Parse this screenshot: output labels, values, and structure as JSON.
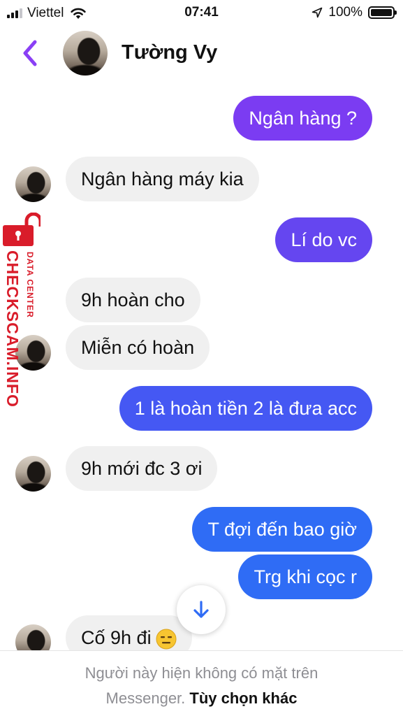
{
  "status_bar": {
    "carrier": "Viettel",
    "time": "07:41",
    "battery": "100%"
  },
  "header": {
    "contact_name": "Tường Vy"
  },
  "messages": [
    {
      "side": "out",
      "text": "Ngân hàng ?"
    },
    {
      "side": "in",
      "text": "Ngân hàng máy kia"
    },
    {
      "side": "out",
      "text": "Lí do vc"
    },
    {
      "side": "in",
      "text": "9h hoàn cho"
    },
    {
      "side": "in",
      "text": "Miễn có hoàn"
    },
    {
      "side": "out",
      "text": "1 là hoàn tiền 2 là đưa acc"
    },
    {
      "side": "in",
      "text": "9h mới đc 3 ơi"
    },
    {
      "side": "out",
      "text": "T đợi đến bao giờ"
    },
    {
      "side": "out",
      "text": "Trg khi cọc r"
    },
    {
      "side": "in",
      "text": "Cố 9h đi",
      "emoji": "expressionless-face-emoji"
    }
  ],
  "watermark": {
    "brand": "CHECKSCAM.INFO",
    "subtitle": "DATA CENTER"
  },
  "footer": {
    "line1": "Người này hiện không có mặt trên",
    "line2_prefix": "Messenger.",
    "line2_link": "Tùy chọn khác"
  },
  "colors": {
    "outgoing_purple": "#7b3cf2",
    "outgoing_violet": "#6546f0",
    "outgoing_indigo": "#4558f3",
    "outgoing_blue": "#2f6cf5",
    "incoming_gray": "#f0f0f0",
    "back_chevron": "#8a3ff5",
    "watermark_red": "#d91c2a"
  }
}
